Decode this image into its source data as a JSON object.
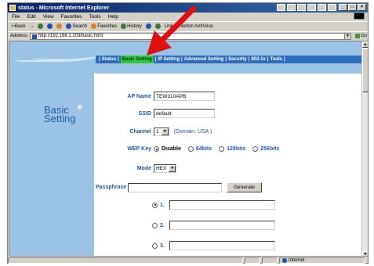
{
  "window": {
    "title": "status - Microsoft Internet Explorer",
    "controls": [
      "_",
      "□",
      "×"
    ]
  },
  "menubar": [
    "File",
    "Edit",
    "View",
    "Favorites",
    "Tools",
    "Help"
  ],
  "toolbar": {
    "back": "⇦Back",
    "forward": "→",
    "search": "Search",
    "favorites": "Favorites",
    "history": "History",
    "links": "Links",
    "norton": "Norton AntiVirus"
  },
  "address": {
    "label": "Address",
    "url": "http://192.168.1.203/basic.html",
    "go": "Go"
  },
  "nav": {
    "items": [
      "Status",
      "Basic Setting",
      "IP Setting",
      "Advanced Setting",
      "Security",
      "802.1x",
      "Tools"
    ],
    "active_index": 1
  },
  "sidebar": {
    "title_line1": "Basic",
    "title_line2": "Setting"
  },
  "form": {
    "ap_name_label": "AP Name",
    "ap_name_value": "TEW310APB",
    "ssid_label": "SSID",
    "ssid_value": "default",
    "channel_label": "Channel",
    "channel_value": "1",
    "domain_text": "(Domain: USA )",
    "wep_label": "WEP Key",
    "wep_options": [
      "Disable",
      "64bits",
      "128bits",
      "256bits"
    ],
    "wep_selected": "Disable",
    "mode_label": "Mode",
    "mode_value": "HEX",
    "passphrase_label": "Passphrase",
    "passphrase_value": "",
    "generate_label": "Generate",
    "keys": [
      {
        "label": "1.",
        "selected": true,
        "value": ""
      },
      {
        "label": "2.",
        "selected": false,
        "value": ""
      },
      {
        "label": "3.",
        "selected": false,
        "value": ""
      }
    ]
  },
  "status": {
    "zone": "Internet"
  },
  "colors": {
    "accent_blue": "#1d5aa8",
    "nav_bar": "#2d6dc0",
    "active_tab": "#2ec83a",
    "panel_bg": "#9bc3e6",
    "annotation_arrow": "#e01010"
  }
}
